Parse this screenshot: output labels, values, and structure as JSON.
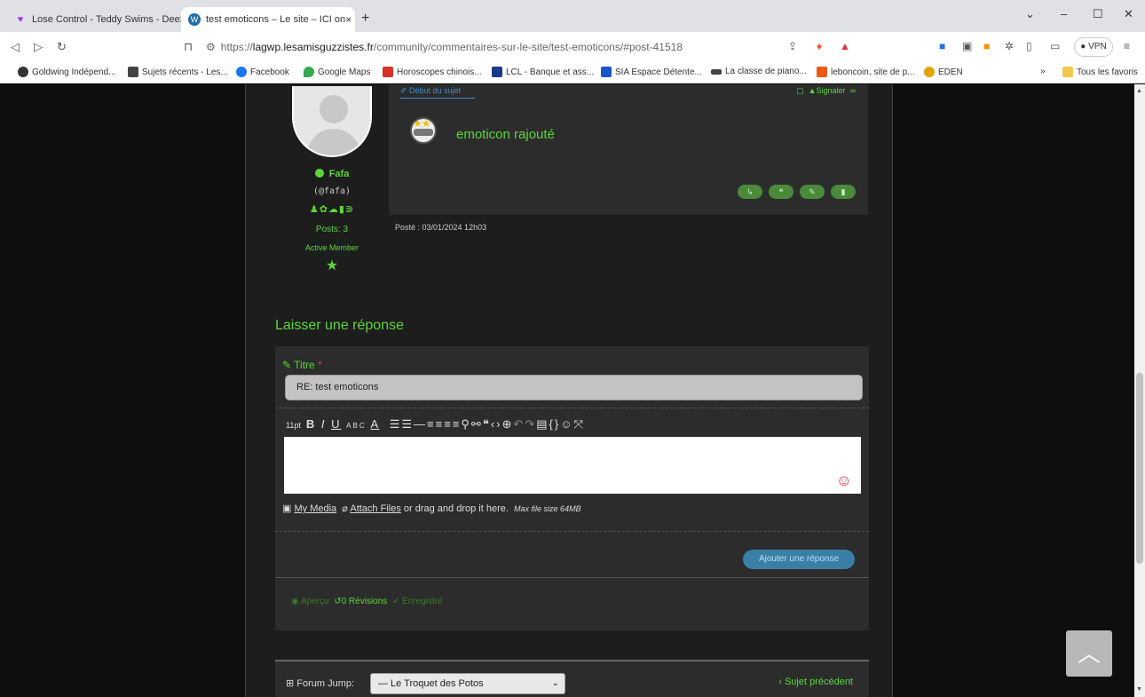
{
  "browser": {
    "tabs": [
      {
        "title": "Lose Control - Teddy Swims - Deezer",
        "icon": "heart-icon",
        "color": "#a238ff"
      },
      {
        "title": "test emoticons – Le site – ICI on",
        "icon": "wordpress-icon",
        "close": "×"
      }
    ],
    "new_tab": "+",
    "window_controls": {
      "dropdown": "⌄",
      "minimize": "–",
      "maximize": "☐",
      "close": "✕"
    },
    "url_scheme": "https://",
    "url_host": "lagwp.lesamisguzzistes.fr",
    "url_path": "/community/commentaires-sur-le-site/test-emoticons/#post-41518",
    "vpn_label": "VPN",
    "bookmarks": [
      {
        "label": "Goldwing Indépend...",
        "color": "#333"
      },
      {
        "label": "Sujets récents - Les...",
        "color": "#444"
      },
      {
        "label": "Facebook",
        "color": "#1877f2"
      },
      {
        "label": "Google Maps",
        "color": "#34a853"
      },
      {
        "label": "Horoscopes chinois...",
        "color": "#d93025"
      },
      {
        "label": "LCL - Banque et ass...",
        "color": "#1a3a8a"
      },
      {
        "label": "SIA Espace Détente...",
        "color": "#1a55c9"
      },
      {
        "label": "La classe de piano...",
        "color": "#444"
      },
      {
        "label": "leboncoin, site de p...",
        "color": "#ec5a13"
      },
      {
        "label": "EDEN",
        "color": "#e2a300"
      }
    ],
    "bookmarks_more": "»",
    "all_bookmarks": "Tous les favoris"
  },
  "post": {
    "author": {
      "name": "Fafa",
      "handle": "(@fafa)",
      "posts": "Posts: 3",
      "rank": "Active Member"
    },
    "start_link": "Début du sujet",
    "report": "Signaler",
    "body": "emoticon rajouté",
    "date": "Posté : 03/01/2024 12h03"
  },
  "reply": {
    "heading": "Laisser une réponse",
    "title_label": "Titre",
    "title_required": "*",
    "title_value": "RE: test emoticons",
    "font_size": "11pt",
    "my_media": "My Media",
    "attach_files": "Attach Files",
    "drop_text": "or drag and drop it here.",
    "max_size": "Max file size 64MB",
    "submit": "Ajouter une réponse",
    "preview": "Aperçu",
    "revisions": "0 Révisions",
    "saved": "Enregistré"
  },
  "forum_jump": {
    "label": "Forum Jump:",
    "selected": "— Le Troquet des Potos",
    "previous": "Sujet précédent"
  },
  "colors": {
    "accent_green": "#5cd63b",
    "link_blue": "#3b8fd6",
    "page_bg": "#0e0e0e",
    "panel_bg": "#2c2c2c"
  }
}
